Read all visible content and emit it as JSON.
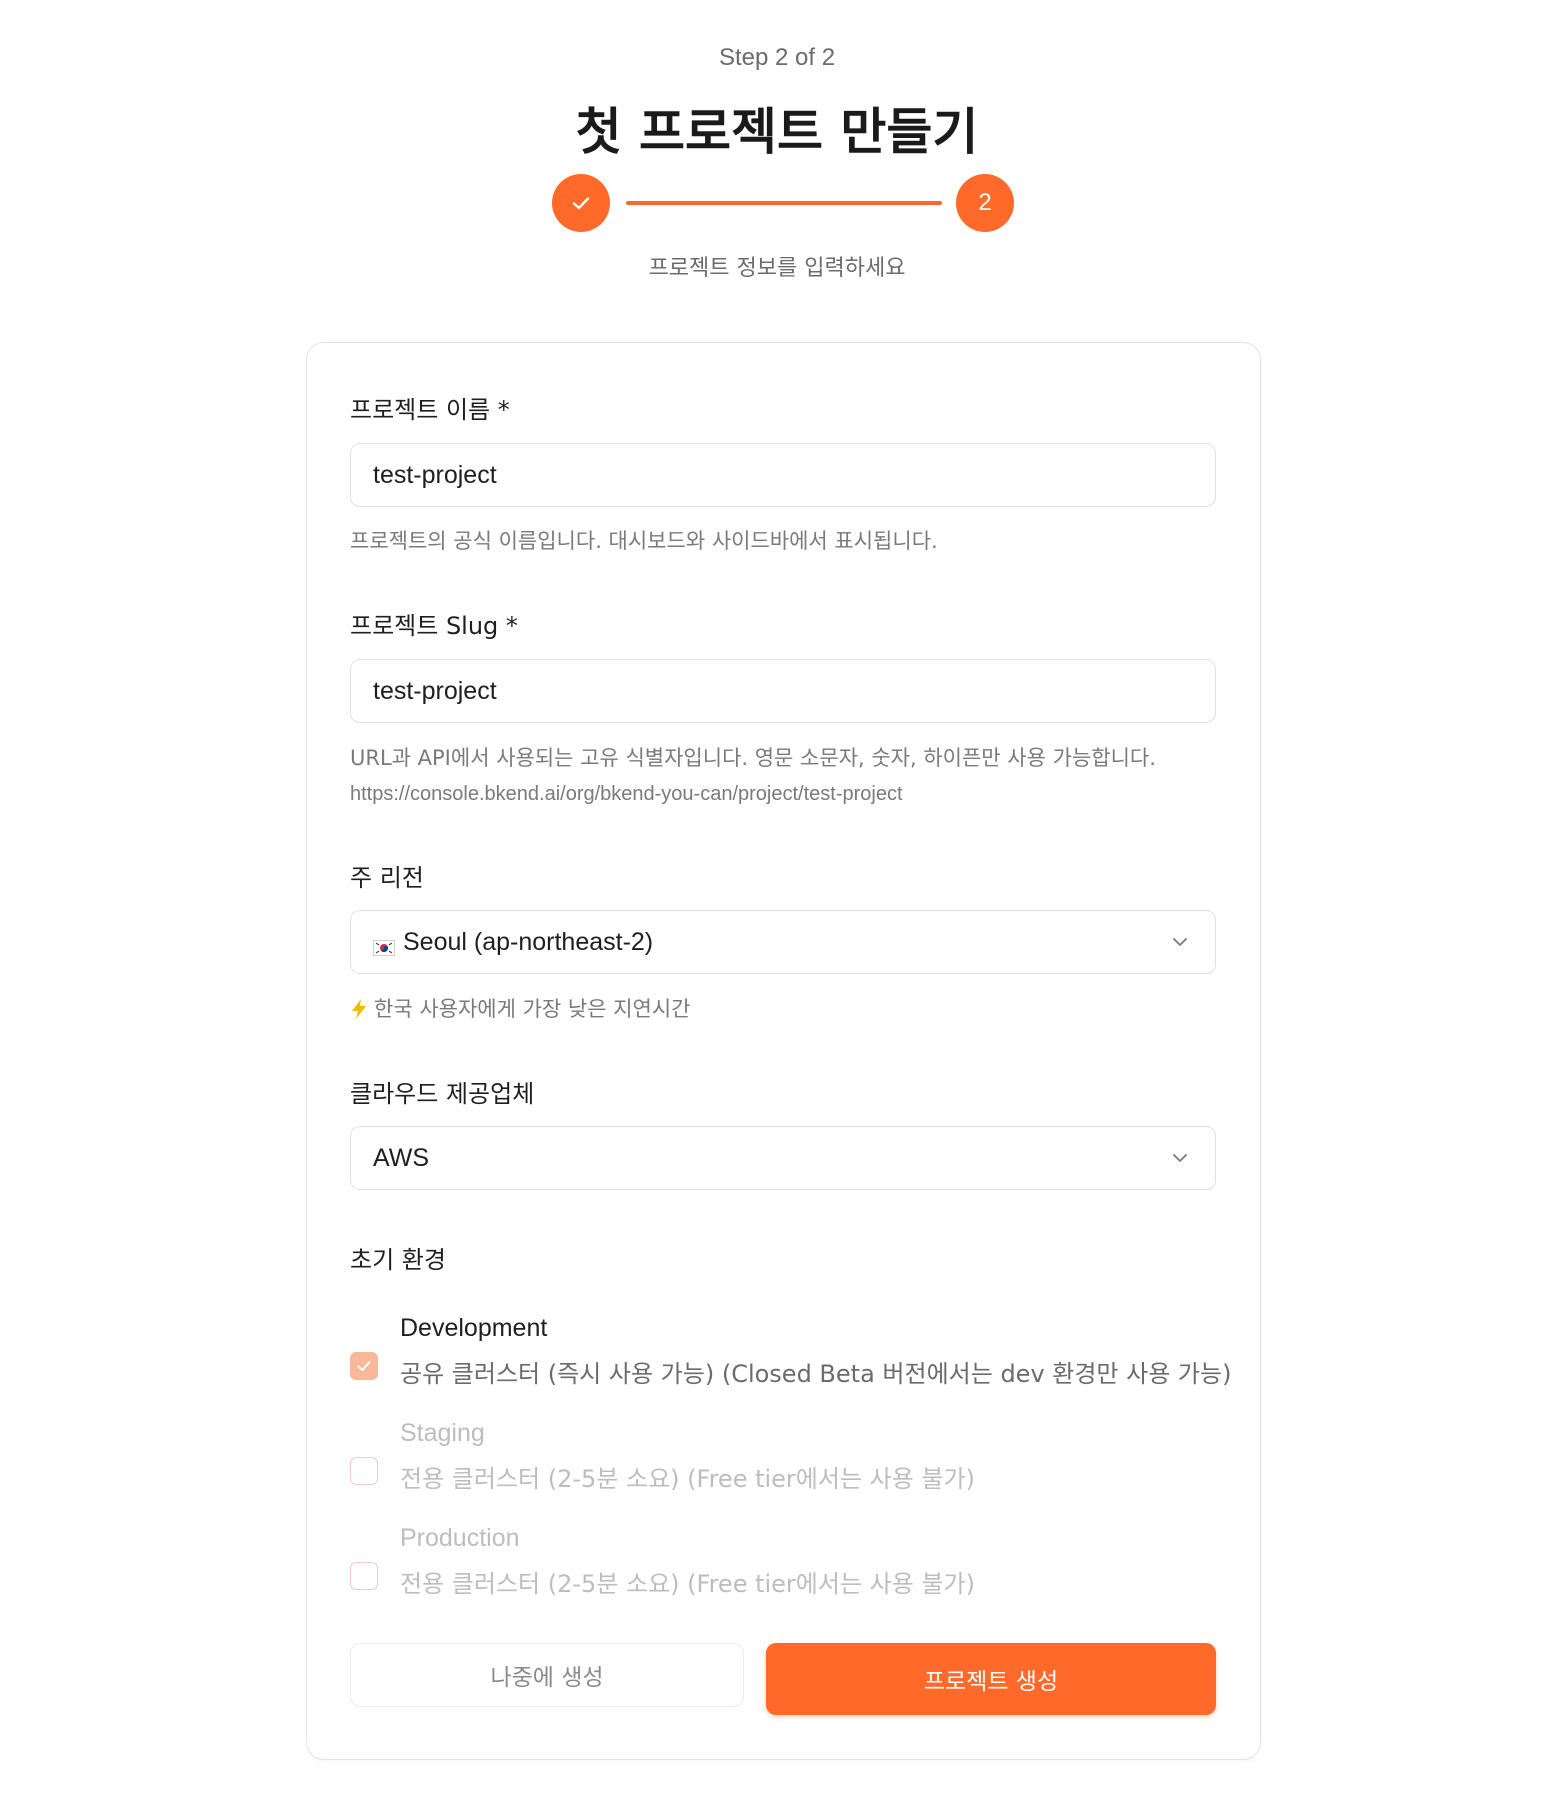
{
  "header": {
    "step_label": "Step 2 of 2",
    "title": "첫 프로젝트 만들기",
    "step2_number": "2",
    "subtitle": "프로젝트 정보를 입력하세요"
  },
  "form": {
    "name": {
      "label": "프로젝트 이름 *",
      "value": "test-project",
      "help": "프로젝트의 공식 이름입니다. 대시보드와 사이드바에서 표시됩니다."
    },
    "slug": {
      "label": "프로젝트 Slug *",
      "value": "test-project",
      "help": "URL과 API에서 사용되는 고유 식별자입니다. 영문 소문자, 숫자, 하이픈만 사용 가능합니다.",
      "url_preview": "https://console.bkend.ai/org/bkend-you-can/project/test-project"
    },
    "region": {
      "label": "주 리전",
      "value": "Seoul (ap-northeast-2)",
      "flag_icon": "korea-flag-icon",
      "hint_icon": "lightning-icon",
      "hint": "한국 사용자에게 가장 낮은 지연시간"
    },
    "provider": {
      "label": "클라우드 제공업체",
      "value": "AWS"
    },
    "environments": {
      "label": "초기 환경",
      "items": [
        {
          "title": "Development",
          "desc": "공유 클러스터 (즉시 사용 가능) (Closed Beta 버전에서는 dev 환경만 사용 가능)",
          "checked": true,
          "disabled": false
        },
        {
          "title": "Staging",
          "desc": "전용 클러스터 (2-5분 소요) (Free tier에서는 사용 불가)",
          "checked": false,
          "disabled": true
        },
        {
          "title": "Production",
          "desc": "전용 클러스터 (2-5분 소요) (Free tier에서는 사용 불가)",
          "checked": false,
          "disabled": true
        }
      ]
    }
  },
  "actions": {
    "later_label": "나중에 생성",
    "create_label": "프로젝트 생성"
  },
  "colors": {
    "accent": "#ff6a2a",
    "checkbox_checked": "#f9b89a"
  }
}
